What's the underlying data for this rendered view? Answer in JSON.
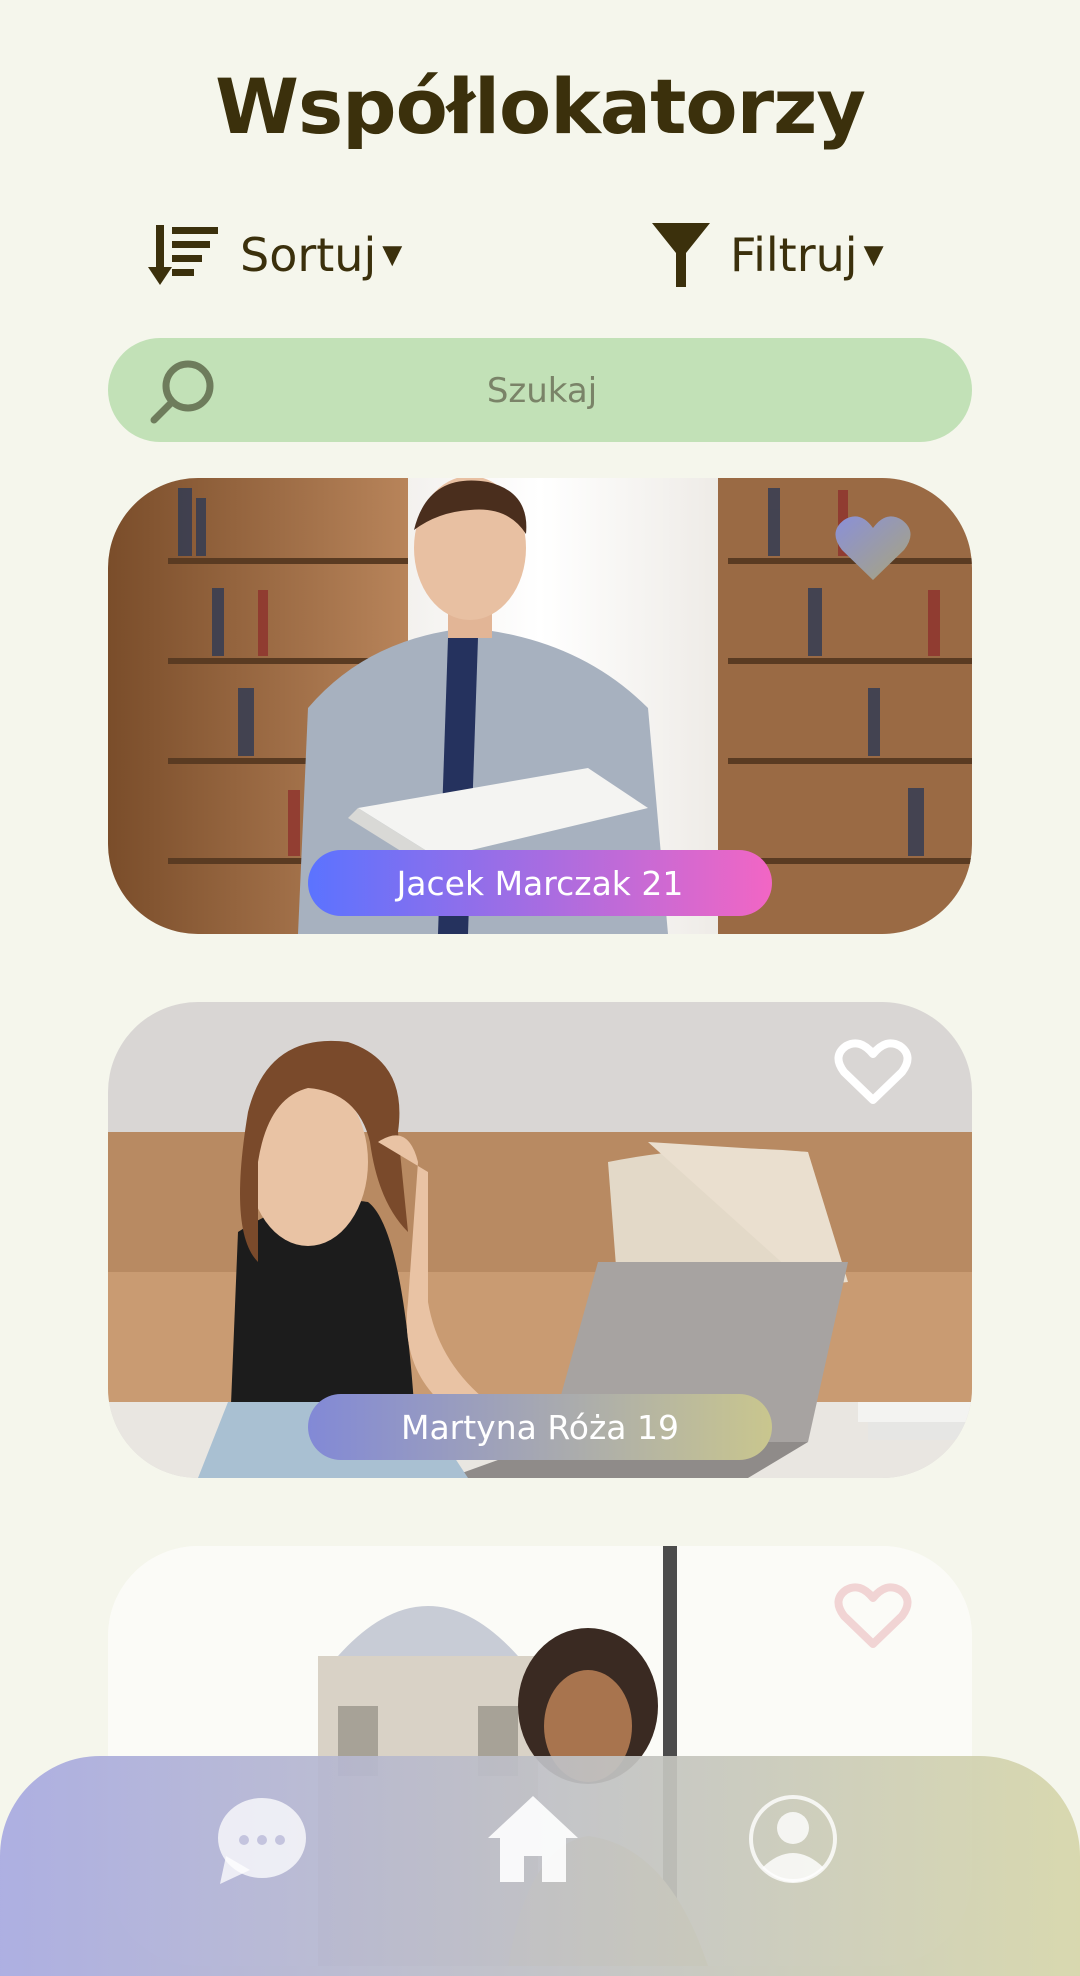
{
  "header": {
    "title": "Współlokatorzy"
  },
  "toolbar": {
    "sort_label": "Sortuj",
    "filter_label": "Filtruj",
    "sort_icon": "sort-icon",
    "filter_icon": "funnel-icon"
  },
  "search": {
    "placeholder": "Szukaj",
    "value": "",
    "icon": "search-icon"
  },
  "profiles": [
    {
      "name": "Jacek Marczak 21",
      "favorite": true
    },
    {
      "name": "Martyna Róża 19",
      "favorite": false
    },
    {
      "name": "",
      "favorite": false
    }
  ],
  "nav": {
    "items": [
      {
        "icon": "chat-icon"
      },
      {
        "icon": "home-icon",
        "active": true
      },
      {
        "icon": "profile-icon"
      }
    ]
  },
  "colors": {
    "background": "#f5f6ec",
    "text": "#3b300c",
    "search_bg": "#c2e1b7",
    "pill1_start": "#5b73ff",
    "pill1_end": "#f266c4",
    "pill2_start": "#8289d6",
    "pill2_end": "#c9c68e"
  }
}
